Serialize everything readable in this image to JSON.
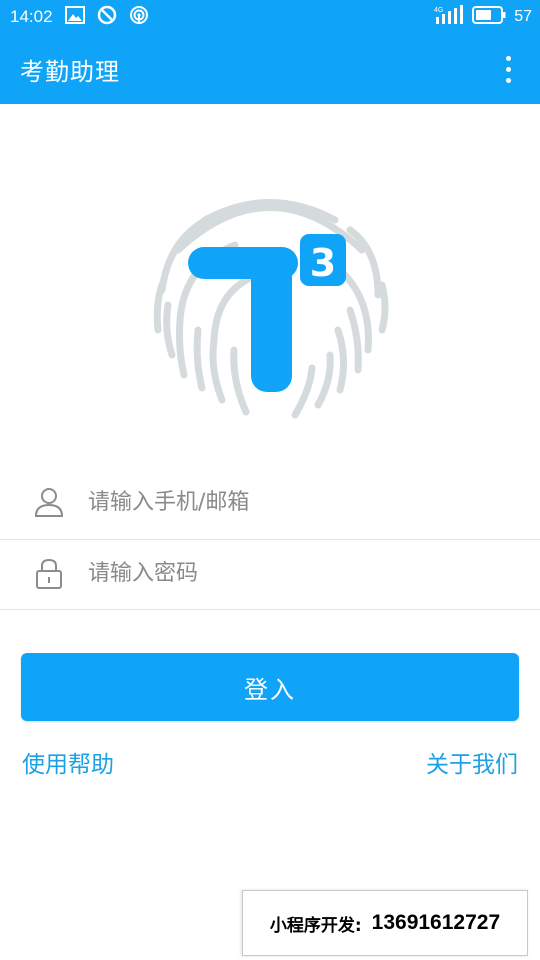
{
  "status_bar": {
    "time": "14:02",
    "network": "4G",
    "battery": "57",
    "icons": [
      "image-icon",
      "blocked-icon",
      "hotspot-icon",
      "signal-icon",
      "battery-icon"
    ]
  },
  "app_bar": {
    "title": "考勤助理",
    "menu_icon": "more-vert-icon"
  },
  "logo": {
    "letter": "T",
    "superscript": "3",
    "icon": "fingerprint-icon"
  },
  "login_form": {
    "account_placeholder": "请输入手机/邮箱",
    "account_value": "",
    "account_icon": "user-icon",
    "password_placeholder": "请输入密码",
    "password_value": "",
    "password_icon": "lock-icon",
    "submit_label": "登入"
  },
  "links": {
    "help": "使用帮助",
    "about": "关于我们"
  },
  "promo": {
    "label": "小程序开发:",
    "phone": "13691612727"
  },
  "colors": {
    "primary": "#10a4f8",
    "link": "#1ba2e6",
    "fingerprint": "#d5dbdc"
  }
}
